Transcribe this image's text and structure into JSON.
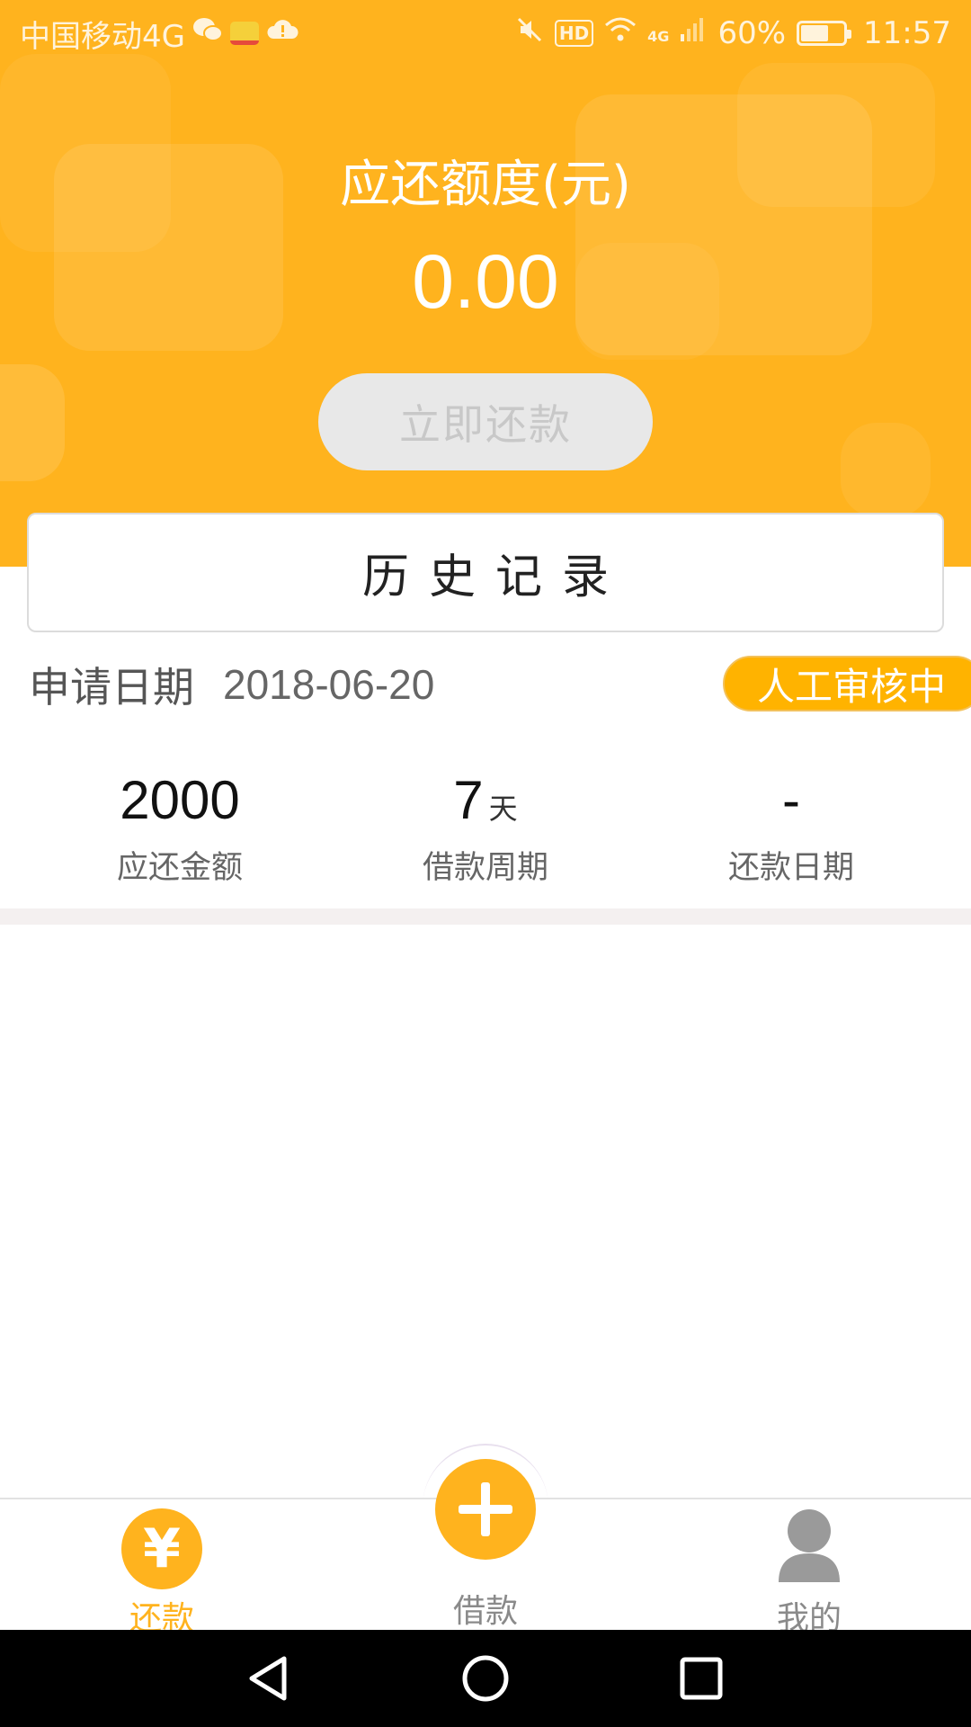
{
  "status_bar": {
    "carrier": "中国移动4G",
    "network": "4G",
    "battery": "60%",
    "battery_level": 0.6,
    "time": "11:57"
  },
  "summary": {
    "title": "应还额度(元)",
    "amount": "0.00",
    "repay_button": "立即还款"
  },
  "history": {
    "title": "历史记录"
  },
  "record": {
    "date_label": "申请日期",
    "date": "2018-06-20",
    "status": "人工审核中",
    "stats": [
      {
        "value": "2000",
        "unit": "",
        "label": "应还金额"
      },
      {
        "value": "7",
        "unit": "天",
        "label": "借款周期"
      },
      {
        "value": "-",
        "unit": "",
        "label": "还款日期"
      }
    ]
  },
  "nav": {
    "repay": "还款",
    "borrow": "借款",
    "mine": "我的"
  },
  "colors": {
    "accent": "#FFB31E",
    "badge": "#FFB300",
    "button_disabled": "#E8E8E8"
  }
}
